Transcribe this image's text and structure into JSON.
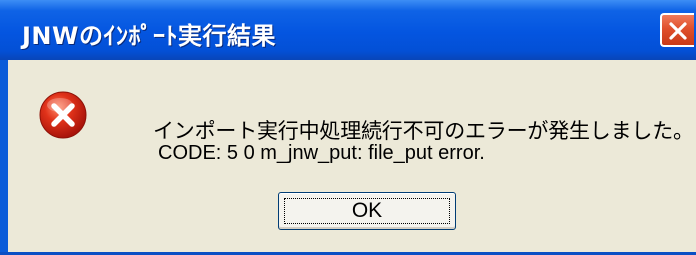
{
  "window": {
    "title": "JNWのｲﾝﾎﾟｰﾄ実行結果",
    "title_bar_color": "#0455e0",
    "close_icon": "close-icon"
  },
  "dialog": {
    "icon": "error-icon",
    "message_line1": "インポート実行中処理続行不可のエラーが発生しました。",
    "message_line2": "CODE: 5 0 m_jnw_put: file_put error.",
    "ok_label": "OK"
  },
  "colors": {
    "panel_background": "#ece9d8",
    "error_red": "#d8200c",
    "close_button": "#e0502c"
  }
}
